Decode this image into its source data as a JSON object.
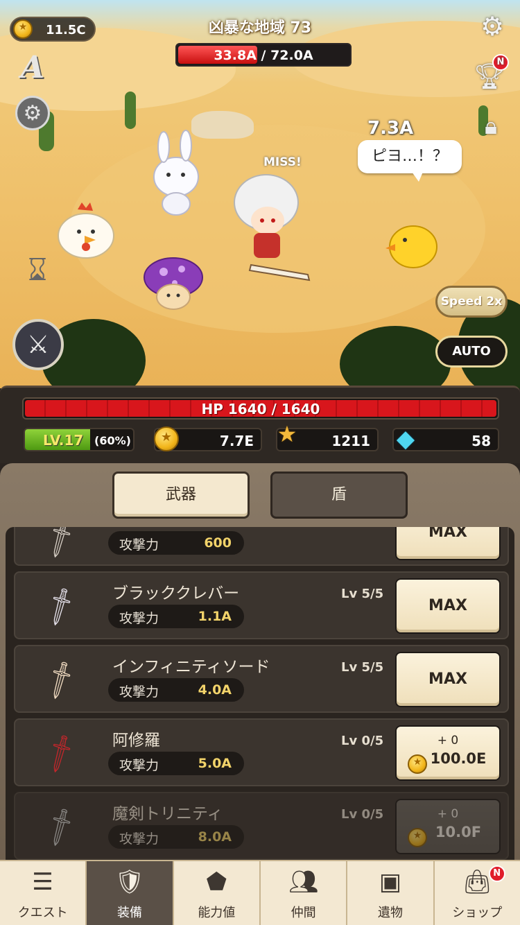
{
  "hud": {
    "coins": "11.5C",
    "stage_title": "凶暴な地域 73",
    "boss_hp_current": "33.8A",
    "boss_hp_separator": " / ",
    "boss_hp_max": "72.0A",
    "boss_hp_fraction": 0.47,
    "trophy_badge": "N"
  },
  "battle": {
    "damage_float": "7.3A",
    "miss_text": "MISS!",
    "speech_bubble": "ピヨ…！？",
    "speed_label": "Speed 2x",
    "auto_label": "AUTO"
  },
  "stats": {
    "hp_text": "HP 1640 / 1640",
    "hp_fraction": 1.0,
    "level": "LV.17",
    "level_pct": "(60%)",
    "level_fraction": 0.6,
    "gold": "7.7E",
    "medals": "1211",
    "gems": "58"
  },
  "tabs": {
    "weapon": "武器",
    "shield": "盾"
  },
  "atk_label": "攻撃力",
  "items": [
    {
      "name": "",
      "atk": "600",
      "lv": "",
      "button": "MAX"
    },
    {
      "name": "ブラッククレバー",
      "atk": "1.1A",
      "lv": "Lv 5/5",
      "button": "MAX"
    },
    {
      "name": "インフィニティソード",
      "atk": "4.0A",
      "lv": "Lv 5/5",
      "button": "MAX"
    },
    {
      "name": "阿修羅",
      "atk": "5.0A",
      "lv": "Lv 0/5",
      "plus": "+ 0",
      "cost": "100.0E"
    },
    {
      "name": "魔剣トリニティ",
      "atk": "8.0A",
      "lv": "Lv 0/5",
      "plus": "+ 0",
      "cost": "10.0F"
    }
  ],
  "nav": [
    {
      "label": "クエスト",
      "icon": "quest-list-icon"
    },
    {
      "label": "装備",
      "icon": "equipment-icon"
    },
    {
      "label": "能力値",
      "icon": "stats-triangle-icon"
    },
    {
      "label": "仲間",
      "icon": "party-icon"
    },
    {
      "label": "遺物",
      "icon": "treasure-chest-icon"
    },
    {
      "label": "ショップ",
      "icon": "shop-bag-icon",
      "badge": "N"
    }
  ],
  "colors": {
    "hp_red": "#d8161c",
    "level_green": "#6cb622",
    "gold_text": "#f2d36a",
    "panel_cream": "#f4e8cf"
  }
}
